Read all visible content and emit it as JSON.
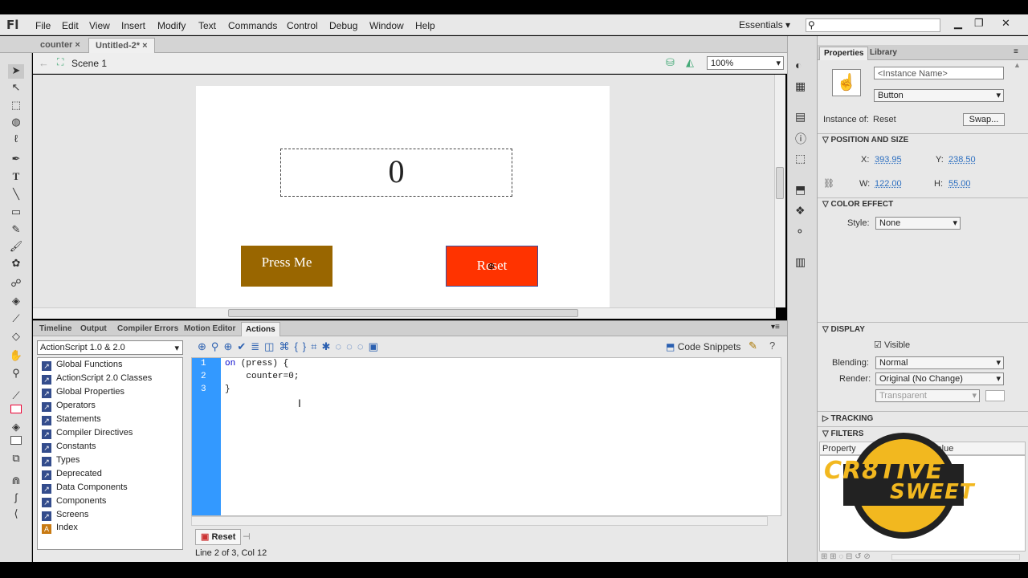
{
  "app": {
    "logo": "Fl"
  },
  "menu": [
    "File",
    "Edit",
    "View",
    "Insert",
    "Modify",
    "Text",
    "Commands",
    "Control",
    "Debug",
    "Window",
    "Help"
  ],
  "workspace": "Essentials",
  "doc_tabs": [
    {
      "label": "counter"
    },
    {
      "label": "Untitled-2*"
    }
  ],
  "editbar": {
    "scene": "Scene 1",
    "zoom": "100%"
  },
  "stage": {
    "counter_value": "0",
    "press_label": "Press Me",
    "reset_label": "Reset"
  },
  "panel_tabs": [
    "Timeline",
    "Output",
    "Compiler Errors",
    "Motion Editor",
    "Actions"
  ],
  "actions": {
    "version_select": "ActionScript 1.0 & 2.0",
    "tree": [
      "Global Functions",
      "ActionScript 2.0 Classes",
      "Global Properties",
      "Operators",
      "Statements",
      "Compiler Directives",
      "Constants",
      "Types",
      "Deprecated",
      "Data Components",
      "Components",
      "Screens",
      "Index"
    ],
    "code_snippets": "Code Snippets",
    "code_lines": [
      {
        "num": "1",
        "kw": "on",
        "rest": " (press) {"
      },
      {
        "num": "2",
        "kw": "",
        "rest": "    counter=0;"
      },
      {
        "num": "3",
        "kw": "",
        "rest": "}"
      }
    ],
    "script_tab": "Reset",
    "status": "Line 2 of 3, Col 12"
  },
  "properties": {
    "tabs": [
      "Properties",
      "Library"
    ],
    "instance_name_placeholder": "<Instance Name>",
    "type": "Button",
    "instance_of_label": "Instance of:",
    "instance_of": "Reset",
    "swap": "Swap...",
    "pos_section": "POSITION AND SIZE",
    "x_label": "X:",
    "x": "393.95",
    "y_label": "Y:",
    "y": "238.50",
    "w_label": "W:",
    "w": "122.00",
    "h_label": "H:",
    "h": "55.00",
    "color_section": "COLOR EFFECT",
    "style_label": "Style:",
    "style": "None",
    "display_section": "DISPLAY",
    "visible": "Visible",
    "blending_label": "Blending:",
    "blending": "Normal",
    "render_label": "Render:",
    "render": "Original (No Change)",
    "transparent": "Transparent",
    "tracking_section": "TRACKING",
    "filters_section": "FILTERS",
    "property_col": "Property",
    "value_col": "Value"
  },
  "watermark": {
    "line1": "CR8TIVE",
    "line2": "SWEET"
  },
  "colors": {
    "press_btn": "#996600",
    "reset_btn": "#ff3300",
    "gutter": "#3399ff"
  }
}
